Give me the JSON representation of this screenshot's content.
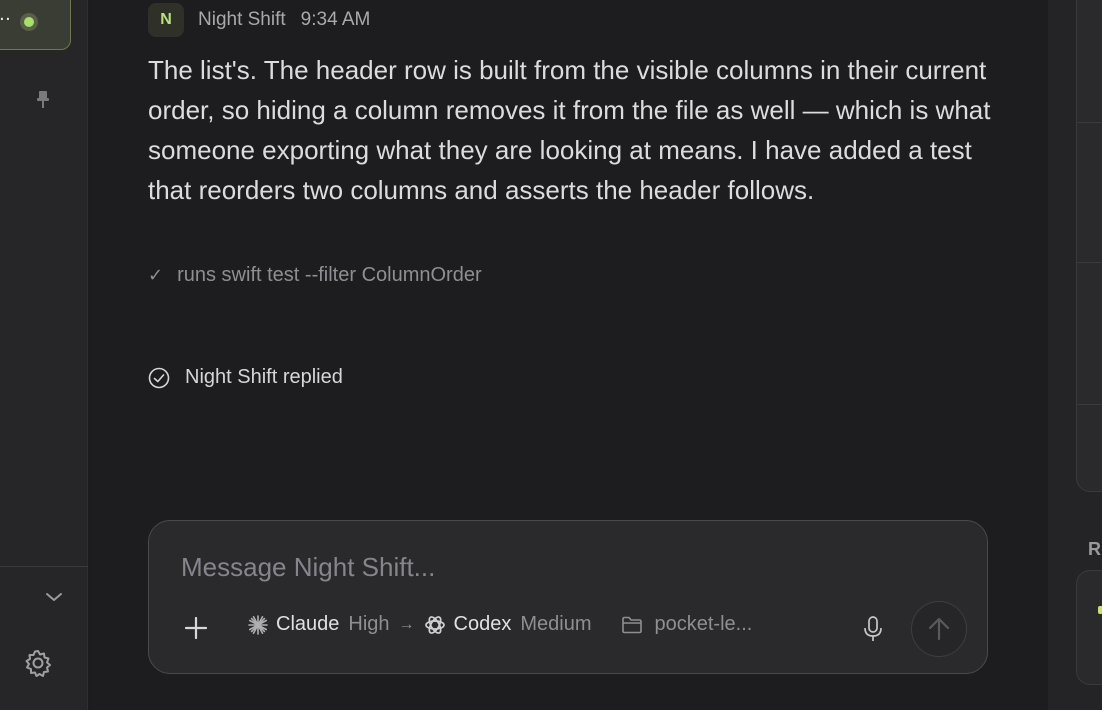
{
  "sidebar": {
    "session_label": "t...",
    "session_status_color": "#a8e06a",
    "icons": [
      "pin-icon",
      "chevron-down-icon",
      "gear-icon"
    ]
  },
  "message": {
    "avatar_letter": "N",
    "author": "Night Shift",
    "time": "9:34 AM",
    "body": "The list's. The header row is built from the visible columns in their current order, so hiding a column removes it from the file as well — which is what someone exporting what they are looking at means. I have added a test that reorders two columns and asserts the header follows.",
    "check_mark": "✓",
    "check_text": "runs swift test --filter ColumnOrder"
  },
  "status": {
    "replied_text": "Night Shift replied"
  },
  "composer": {
    "placeholder": "Message Night Shift...",
    "model_primary": "Claude",
    "model_primary_level": "High",
    "arrow": "→",
    "model_secondary": "Codex",
    "model_secondary_level": "Medium",
    "folder": "pocket-le..."
  },
  "right_panel": {
    "label": "R"
  }
}
